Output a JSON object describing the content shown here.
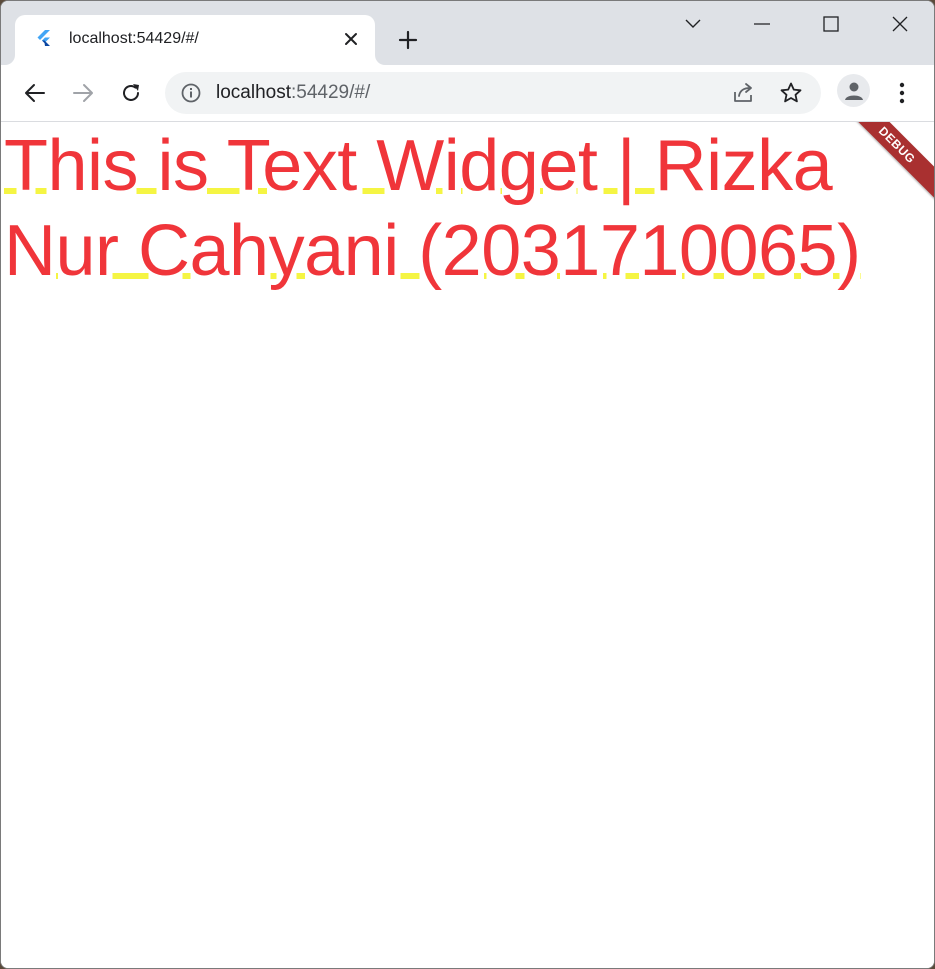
{
  "tab": {
    "title": "localhost:54429/#/",
    "favicon": "flutter-icon"
  },
  "omnibox": {
    "url_host": "localhost",
    "url_rest": ":54429/#/"
  },
  "content": {
    "text": "This is Text Widget | Rizka Nur Cahyani (2031710065)"
  },
  "debug_banner": {
    "label": "DEBUG"
  },
  "colors": {
    "text": "#f0353a",
    "underline": "#f5f543",
    "debug_banner": "#a93030",
    "tabstrip": "#dee1e6"
  },
  "icons": {
    "back": "arrow-left-icon",
    "forward": "arrow-right-icon",
    "reload": "reload-icon",
    "site_info": "info-icon",
    "share": "share-icon",
    "bookmark": "star-icon",
    "profile": "person-icon",
    "menu": "kebab-menu-icon",
    "tab_close": "close-icon",
    "new_tab": "plus-icon",
    "tab_search": "chevron-down-icon",
    "minimize": "minimize-icon",
    "maximize": "maximize-icon",
    "window_close": "window-close-icon"
  }
}
